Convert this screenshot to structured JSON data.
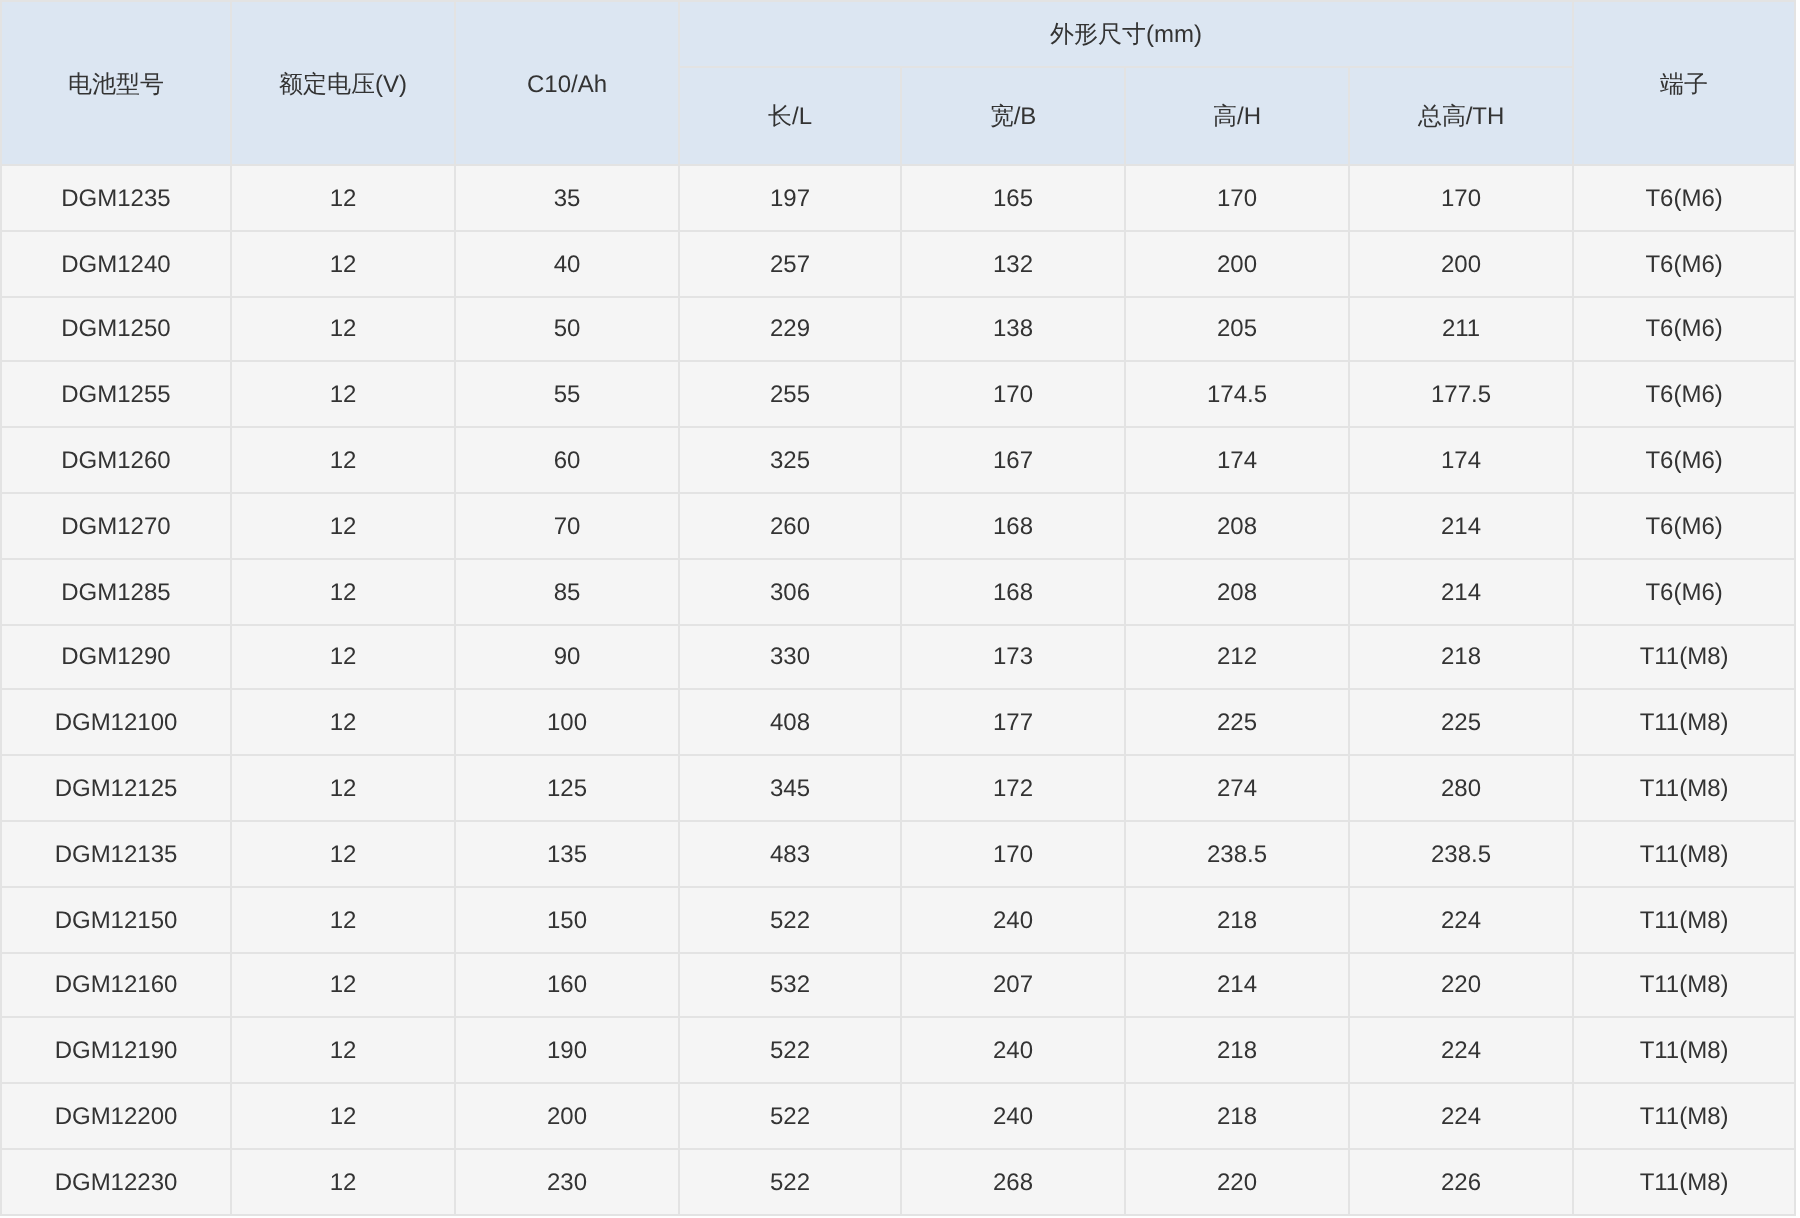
{
  "table": {
    "columns": {
      "model": "电池型号",
      "voltage": "额定电压(V)",
      "capacity": "C10/Ah",
      "dimensions": {
        "label": "外形尺寸(mm)",
        "sub": [
          "长/L",
          "宽/B",
          "高/H",
          "总高/TH"
        ]
      },
      "terminal": "端子"
    },
    "rows": [
      [
        "DGM1235",
        "12",
        "35",
        "197",
        "165",
        "170",
        "170",
        "T6(M6)"
      ],
      [
        "DGM1240",
        "12",
        "40",
        "257",
        "132",
        "200",
        "200",
        "T6(M6)"
      ],
      [
        "DGM1250",
        "12",
        "50",
        "229",
        "138",
        "205",
        "211",
        "T6(M6)"
      ],
      [
        "DGM1255",
        "12",
        "55",
        "255",
        "170",
        "174.5",
        "177.5",
        "T6(M6)"
      ],
      [
        "DGM1260",
        "12",
        "60",
        "325",
        "167",
        "174",
        "174",
        "T6(M6)"
      ],
      [
        "DGM1270",
        "12",
        "70",
        "260",
        "168",
        "208",
        "214",
        "T6(M6)"
      ],
      [
        "DGM1285",
        "12",
        "85",
        "306",
        "168",
        "208",
        "214",
        "T6(M6)"
      ],
      [
        "DGM1290",
        "12",
        "90",
        "330",
        "173",
        "212",
        "218",
        "T11(M8)"
      ],
      [
        "DGM12100",
        "12",
        "100",
        "408",
        "177",
        "225",
        "225",
        "T11(M8)"
      ],
      [
        "DGM12125",
        "12",
        "125",
        "345",
        "172",
        "274",
        "280",
        "T11(M8)"
      ],
      [
        "DGM12135",
        "12",
        "135",
        "483",
        "170",
        "238.5",
        "238.5",
        "T11(M8)"
      ],
      [
        "DGM12150",
        "12",
        "150",
        "522",
        "240",
        "218",
        "224",
        "T11(M8)"
      ],
      [
        "DGM12160",
        "12",
        "160",
        "532",
        "207",
        "214",
        "220",
        "T11(M8)"
      ],
      [
        "DGM12190",
        "12",
        "190",
        "522",
        "240",
        "218",
        "224",
        "T11(M8)"
      ],
      [
        "DGM12200",
        "12",
        "200",
        "522",
        "240",
        "218",
        "224",
        "T11(M8)"
      ],
      [
        "DGM12230",
        "12",
        "230",
        "522",
        "268",
        "220",
        "226",
        "T11(M8)"
      ]
    ]
  }
}
